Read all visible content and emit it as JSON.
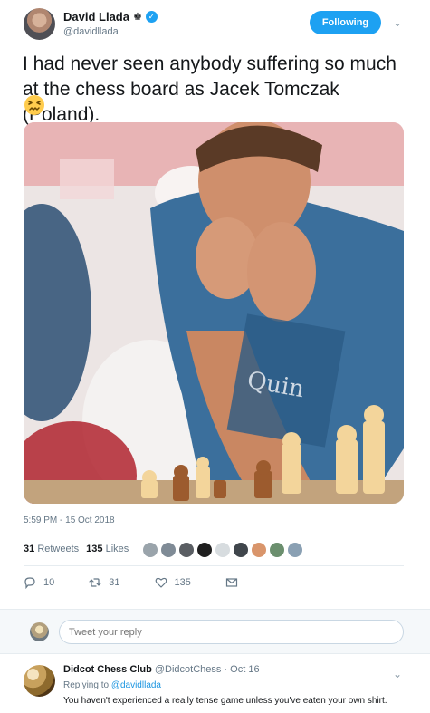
{
  "tweet": {
    "display_name": "David Llada",
    "crown_emoji": "♚",
    "verified": "✓",
    "handle": "@davidllada",
    "follow_label": "Following",
    "text": "I had never seen anybody suffering so much at the chess board as Jacek Tomczak (Poland).",
    "emoji": "confounded-face",
    "timestamp": "5:59 PM - 15 Oct 2018",
    "retweets_count": "31",
    "retweets_label": "Retweets",
    "likes_count": "135",
    "likes_label": "Likes",
    "actions": {
      "reply_count": "10",
      "retweet_count": "31",
      "like_count": "135"
    }
  },
  "reply_box": {
    "placeholder": "Tweet your reply"
  },
  "reply": {
    "name": "Didcot Chess Club",
    "handle": "@DidcotChess",
    "separator": " · ",
    "date": "Oct 16",
    "replying_to_label": "Replying to",
    "replying_to_handle": "@davidllada",
    "text": "You haven't experienced a really tense game unless you've eaten your own shirt."
  },
  "colors": {
    "accent": "#1da1f2",
    "muted": "#657786",
    "link": "#1b95e0"
  }
}
